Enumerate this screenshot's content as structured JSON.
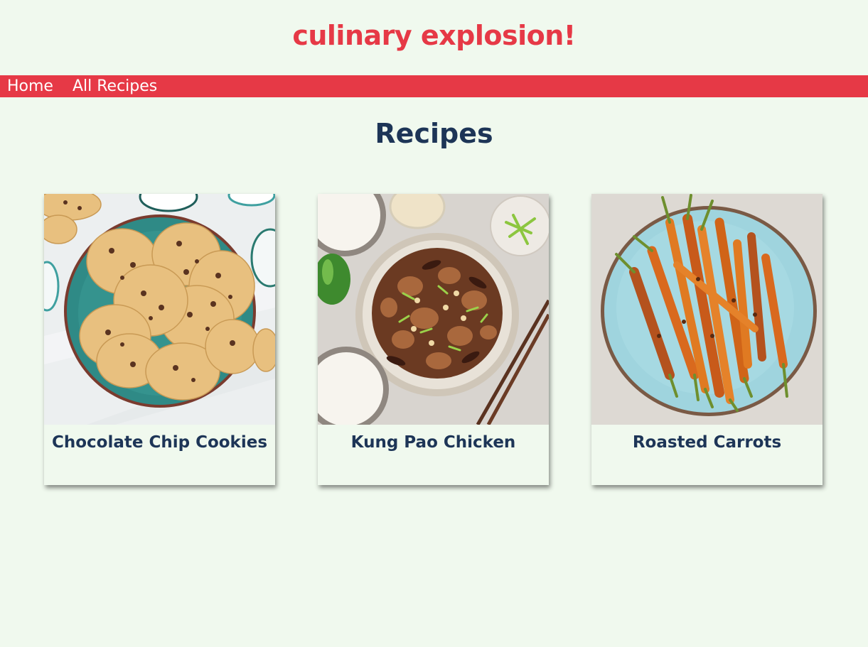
{
  "site": {
    "title": "culinary explosion!"
  },
  "nav": {
    "items": [
      {
        "label": "Home"
      },
      {
        "label": "All Recipes"
      }
    ]
  },
  "main": {
    "heading": "Recipes",
    "recipes": [
      {
        "title": "Chocolate Chip Cookies",
        "image": "cookies-photo"
      },
      {
        "title": "Kung Pao Chicken",
        "image": "kung-pao-photo"
      },
      {
        "title": "Roasted Carrots",
        "image": "carrots-photo"
      }
    ]
  },
  "colors": {
    "background": "#f0f9ee",
    "accent": "#e63946",
    "heading": "#1d3557"
  }
}
